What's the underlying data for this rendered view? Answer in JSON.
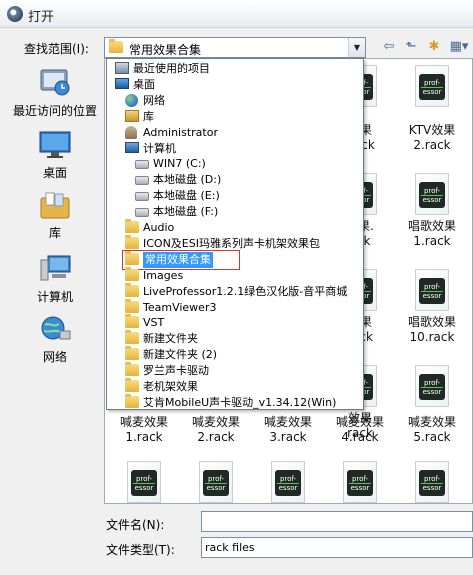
{
  "window": {
    "title": "打开"
  },
  "lookin": {
    "label": "查找范围(I):",
    "value": "常用效果合集"
  },
  "toolbar": {
    "back_glyph": "⇦",
    "up_glyph": "⬑",
    "new_folder_glyph": "✱",
    "views_glyph": "▦▾"
  },
  "places": [
    {
      "label": "最近访问的位置",
      "icon": "recent-places-icon"
    },
    {
      "label": "桌面",
      "icon": "desktop-icon"
    },
    {
      "label": "库",
      "icon": "library-icon"
    },
    {
      "label": "计算机",
      "icon": "computer-icon"
    },
    {
      "label": "网络",
      "icon": "network-icon"
    }
  ],
  "dropdown_items": [
    {
      "label": "最近使用的项目",
      "indent": 0,
      "icon": "recent"
    },
    {
      "label": "桌面",
      "indent": 0,
      "icon": "desktop"
    },
    {
      "label": "网络",
      "indent": 1,
      "icon": "network"
    },
    {
      "label": "库",
      "indent": 1,
      "icon": "library"
    },
    {
      "label": "Administrator",
      "indent": 1,
      "icon": "user"
    },
    {
      "label": "计算机",
      "indent": 1,
      "icon": "computer"
    },
    {
      "label": "WIN7 (C:)",
      "indent": 2,
      "icon": "drive"
    },
    {
      "label": "本地磁盘 (D:)",
      "indent": 2,
      "icon": "drive"
    },
    {
      "label": "本地磁盘 (E:)",
      "indent": 2,
      "icon": "drive"
    },
    {
      "label": "本地磁盘 (F:)",
      "indent": 2,
      "icon": "drive"
    },
    {
      "label": "Audio",
      "indent": 1,
      "icon": "folder"
    },
    {
      "label": "ICON及ESI玛雅系列声卡机架效果包",
      "indent": 1,
      "icon": "folder"
    },
    {
      "label": "常用效果合集",
      "indent": 1,
      "icon": "folder",
      "selected": true
    },
    {
      "label": "Images",
      "indent": 1,
      "icon": "folder"
    },
    {
      "label": "LiveProfessor1.2.1绿色汉化版-音平商城",
      "indent": 1,
      "icon": "folder"
    },
    {
      "label": "TeamViewer3",
      "indent": 1,
      "icon": "folder"
    },
    {
      "label": "VST",
      "indent": 1,
      "icon": "folder"
    },
    {
      "label": "新建文件夹",
      "indent": 1,
      "icon": "folder"
    },
    {
      "label": "新建文件夹 (2)",
      "indent": 1,
      "icon": "folder"
    },
    {
      "label": "罗兰声卡驱动",
      "indent": 1,
      "icon": "folder"
    },
    {
      "label": "老机架效果",
      "indent": 1,
      "icon": "folder"
    },
    {
      "label": "艾肯MobileU声卡驱动_v1.34.12(Win)",
      "indent": 1,
      "icon": "folder"
    }
  ],
  "files": [
    {
      "label": "",
      "row": 0,
      "col": 3,
      "icon": true
    },
    {
      "label": "",
      "row": 0,
      "col": 4,
      "icon": true
    },
    {
      "label": "效果\n.rack",
      "row": 1,
      "col": 3,
      "icon": false
    },
    {
      "label": "KTV效果\n2.rack",
      "row": 1,
      "col": 4,
      "icon": false
    },
    {
      "label": "效果.\nack",
      "row": 2,
      "col": 3,
      "icon": true
    },
    {
      "label": "唱歌效果\n1.rack",
      "row": 2,
      "col": 4,
      "icon": true
    },
    {
      "label": "效果\nrack",
      "row": 3,
      "col": 3,
      "icon": true
    },
    {
      "label": "唱歌效果\n10.rack",
      "row": 3,
      "col": 4,
      "icon": true
    },
    {
      "label": "效果\nrack",
      "row": 4,
      "col": 3,
      "icon": true
    },
    {
      "label": "",
      "row": 4,
      "col": 4,
      "icon": true
    },
    {
      "label": "喊麦效果\n1.rack",
      "row": 5,
      "col": 0,
      "icon": false
    },
    {
      "label": "喊麦效果\n2.rack",
      "row": 5,
      "col": 1,
      "icon": false
    },
    {
      "label": "喊麦效果\n3.rack",
      "row": 5,
      "col": 2,
      "icon": false
    },
    {
      "label": "喊麦效果\n4.rack",
      "row": 5,
      "col": 3,
      "icon": false
    },
    {
      "label": "喊麦效果\n5.rack",
      "row": 5,
      "col": 4,
      "icon": false
    },
    {
      "label": "",
      "row": 6,
      "col": 0,
      "icon": true
    },
    {
      "label": "",
      "row": 6,
      "col": 1,
      "icon": true
    },
    {
      "label": "",
      "row": 6,
      "col": 2,
      "icon": true
    },
    {
      "label": "",
      "row": 6,
      "col": 3,
      "icon": true
    },
    {
      "label": "",
      "row": 6,
      "col": 4,
      "icon": true
    }
  ],
  "file_badge_text": "prof-\nessor",
  "filename": {
    "label": "文件名(N):",
    "value": ""
  },
  "filetype": {
    "label": "文件类型(T):",
    "value": "rack files"
  }
}
